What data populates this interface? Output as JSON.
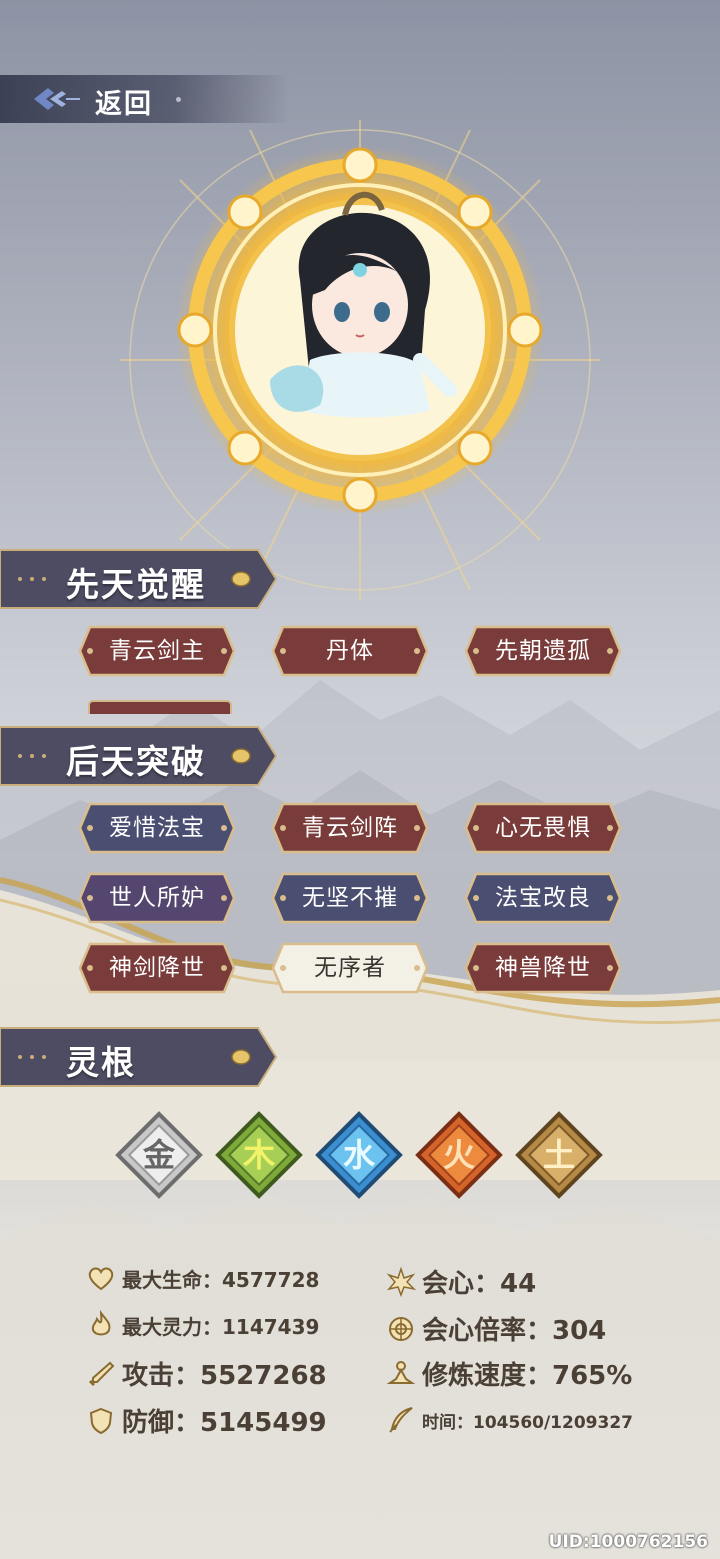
{
  "nav": {
    "back_label": "返回"
  },
  "sections": {
    "innate": {
      "title": "先天觉醒",
      "tags": [
        "青云剑主",
        "丹体",
        "先朝遗孤"
      ]
    },
    "acquired": {
      "title": "后天突破",
      "tags": [
        {
          "label": "爱惜法宝",
          "style": "blue"
        },
        {
          "label": "青云剑阵",
          "style": "red"
        },
        {
          "label": "心无畏惧",
          "style": "red"
        },
        {
          "label": "世人所妒",
          "style": "purple"
        },
        {
          "label": "无坚不摧",
          "style": "blue"
        },
        {
          "label": "法宝改良",
          "style": "blue"
        },
        {
          "label": "神剑降世",
          "style": "red"
        },
        {
          "label": "无序者",
          "style": "light"
        },
        {
          "label": "神兽降世",
          "style": "red"
        }
      ]
    },
    "spirit_root": {
      "title": "灵根",
      "elements": [
        {
          "glyph": "金",
          "color": "#c8c8c8",
          "icon": "metal-root-icon"
        },
        {
          "glyph": "木",
          "color": "#7faa3a",
          "icon": "wood-root-icon"
        },
        {
          "glyph": "水",
          "color": "#3b8fd1",
          "icon": "water-root-icon"
        },
        {
          "glyph": "火",
          "color": "#d4642a",
          "icon": "fire-root-icon"
        },
        {
          "glyph": "土",
          "color": "#b68a45",
          "icon": "earth-root-icon"
        }
      ]
    }
  },
  "stats": {
    "max_hp": "最大生命：4577728",
    "max_mana": "最大灵力：1147439",
    "attack": "攻击：5527268",
    "defense": "防御：5145499",
    "crit": "会心：44",
    "crit_rate": "会心倍率：304",
    "cultivation_speed": "修炼速度：765%",
    "time": "时间：104560/1209327"
  },
  "uid": "UID:1000762156",
  "colors": {
    "tag_red": "#7a3c3a",
    "tag_blue": "#4a4f72",
    "tag_purple": "#54466e",
    "tag_border": "#d9bd8c",
    "header_bg": "#4d4c62"
  }
}
